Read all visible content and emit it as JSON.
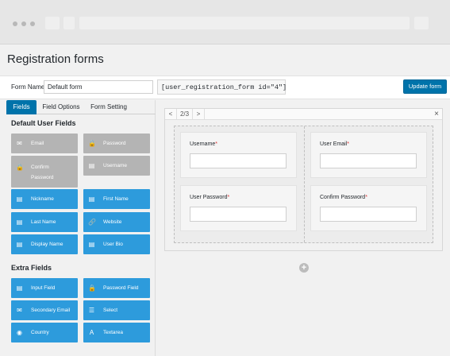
{
  "page": {
    "title": "Registration forms"
  },
  "topbar": {
    "form_name_label": "Form Name",
    "form_name_value": "Default form",
    "shortcode": "[user_registration_form id=\"4\"]",
    "update_label": "Update form"
  },
  "tabs": [
    {
      "label": "Fields",
      "active": true
    },
    {
      "label": "Field Options",
      "active": false
    },
    {
      "label": "Form Setting",
      "active": false
    }
  ],
  "default_fields": {
    "title": "Default User Fields",
    "items": [
      {
        "label": "Email",
        "icon": "email-icon",
        "state": "used"
      },
      {
        "label": "Password",
        "icon": "lock-icon",
        "state": "used"
      },
      {
        "label": "Confirm Password",
        "icon": "lock-icon",
        "state": "used"
      },
      {
        "label": "Username",
        "icon": "id-card-icon",
        "state": "used"
      },
      {
        "label": "Nickname",
        "icon": "id-card-icon",
        "state": "available"
      },
      {
        "label": "First Name",
        "icon": "id-card-icon",
        "state": "available"
      },
      {
        "label": "Last Name",
        "icon": "id-card-icon",
        "state": "available"
      },
      {
        "label": "Website",
        "icon": "link-icon",
        "state": "available"
      },
      {
        "label": "Display Name",
        "icon": "id-card-icon",
        "state": "available"
      },
      {
        "label": "User Bio",
        "icon": "id-card-icon",
        "state": "available"
      }
    ]
  },
  "extra_fields": {
    "title": "Extra Fields",
    "items": [
      {
        "label": "Input Field",
        "icon": "id-card-icon"
      },
      {
        "label": "Password Field",
        "icon": "lock-icon"
      },
      {
        "label": "Secondary Email",
        "icon": "email-icon"
      },
      {
        "label": "Select",
        "icon": "list-icon"
      },
      {
        "label": "Country",
        "icon": "globe-icon"
      },
      {
        "label": "Textarea",
        "icon": "text-icon"
      }
    ]
  },
  "builder": {
    "prev": "<",
    "page": "2/3",
    "next": ">",
    "close": "×",
    "fields": [
      {
        "label": "Username",
        "required": "*"
      },
      {
        "label": "User Email",
        "required": "*"
      },
      {
        "label": "User Password",
        "required": "*"
      },
      {
        "label": "Confirm Password",
        "required": "*"
      }
    ],
    "add": "+"
  },
  "colors": {
    "accent": "#0073aa",
    "field_button": "#2d9bdc",
    "used_field": "#b4b4b4",
    "required": "#dc3232"
  }
}
